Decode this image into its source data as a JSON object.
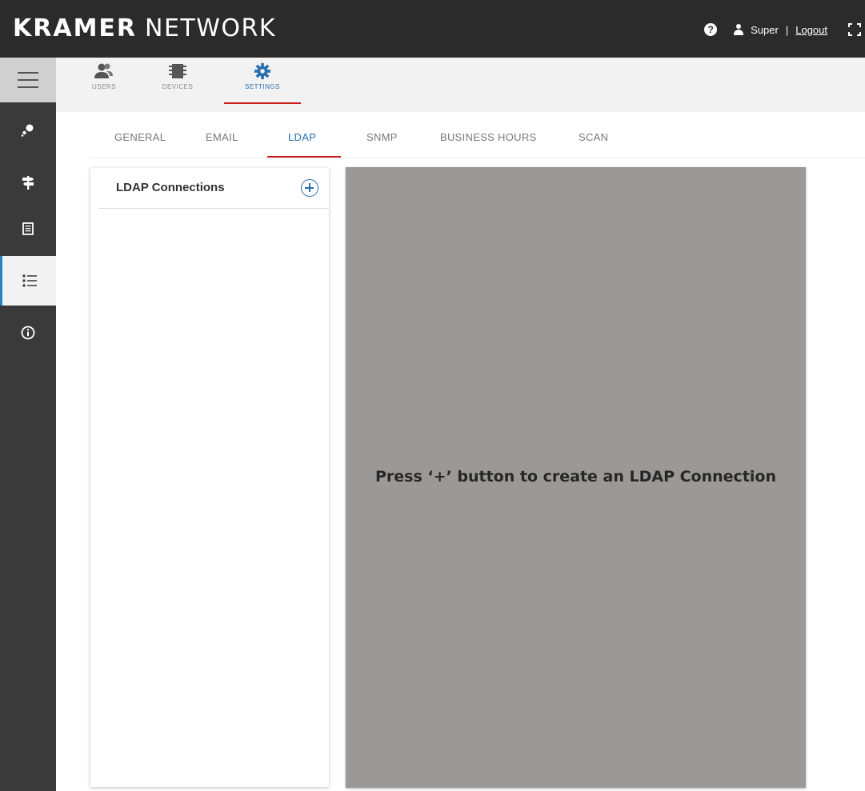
{
  "header": {
    "brand_bold": "KRAMER",
    "brand_light": "NETWORK",
    "help_icon": "?",
    "user": "Super",
    "separator": "|",
    "logout": "Logout"
  },
  "sidebar": {
    "items": [
      {
        "icon": "hamburger-menu-icon"
      },
      {
        "icon": "network-nodes-icon"
      },
      {
        "icon": "signpost-icon"
      },
      {
        "icon": "document-icon"
      },
      {
        "icon": "list-icon",
        "active": true
      },
      {
        "icon": "info-icon"
      }
    ]
  },
  "topnav": {
    "items": [
      {
        "label": "USERS",
        "icon": "users-icon"
      },
      {
        "label": "DEVICES",
        "icon": "devices-icon"
      },
      {
        "label": "SETTINGS",
        "icon": "gear-icon",
        "active": true
      }
    ]
  },
  "tabs": [
    {
      "label": "GENERAL"
    },
    {
      "label": "EMAIL"
    },
    {
      "label": "LDAP",
      "active": true
    },
    {
      "label": "SNMP"
    },
    {
      "label": "BUSINESS HOURS"
    },
    {
      "label": "SCAN"
    }
  ],
  "ldap_panel": {
    "title": "LDAP Connections",
    "add_icon": "plus-circle-icon"
  },
  "content": {
    "message": "Press ‘+’ button to create an LDAP Connection"
  },
  "colors": {
    "header_bg": "#2b2b2b",
    "sidebar_bg": "#3a3a3a",
    "accent_blue": "#2a6fb0",
    "accent_red": "#c81e1e",
    "content_gray": "#9a9998"
  }
}
